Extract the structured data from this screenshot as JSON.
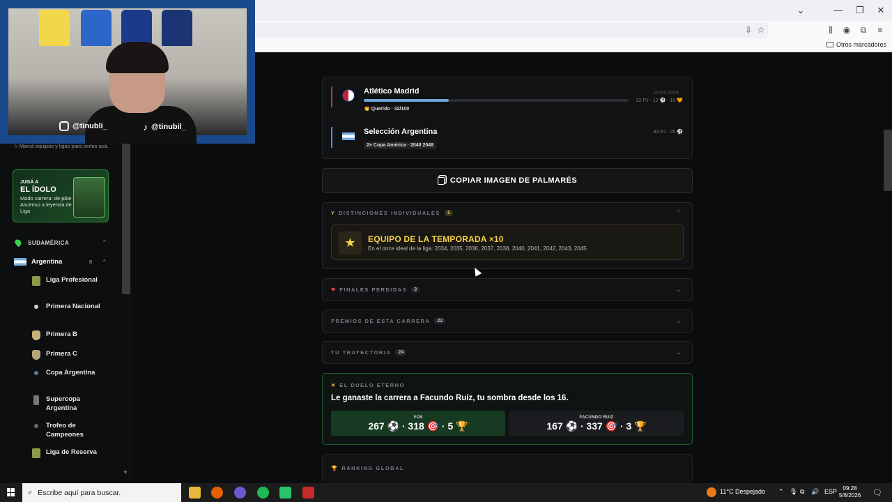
{
  "browser": {
    "bookmarks_other": "Otros marcadores"
  },
  "webcam": {
    "instagram_handle": "@tinubli_",
    "tiktok_handle": "@tinubil_"
  },
  "sidebar": {
    "hint": "Marcá equipos y ligas para verlos acá.",
    "promo": {
      "small": "JUGÁ A",
      "title": "EL ÍDOLO",
      "desc": "Modo carrera: de pibe del Ascenso a leyenda de la Liga"
    },
    "region": "SUDAMÉRICA",
    "country": "Argentina",
    "country_count": "8",
    "leagues": [
      {
        "label": "Liga Profesional"
      },
      {
        "label": "Primera Nacional"
      },
      {
        "label": "Primera B"
      },
      {
        "label": "Primera C"
      },
      {
        "label": "Copa Argentina"
      },
      {
        "label": "Supercopa Argentina"
      },
      {
        "label": "Trofeo de Campeones"
      },
      {
        "label": "Liga de Reserva"
      }
    ]
  },
  "career": [
    {
      "club": "Atlético Madrid",
      "years": "2049-2049",
      "stats": "22 PJ · 12 ⚽ · 10 🧡",
      "tag": "👏 Querido · 32/100",
      "progress": 0.32
    },
    {
      "club": "Selección Argentina",
      "stats": "93 PJ · 26 ⚽",
      "tag": "2× Copa América · 2040 2048"
    }
  ],
  "copy_button": "COPIAR IMAGEN DE PALMARÉS",
  "sections": {
    "distinciones": {
      "label": "DISTINCIONES INDIVIDUALES",
      "count": "1"
    },
    "finales": {
      "label": "FINALES PERDIDAS",
      "count": "3"
    },
    "premios": {
      "label": "PREMIOS DE ESTA CARRERA",
      "count": "22"
    },
    "trayectoria": {
      "label": "TU TRAYECTORIA",
      "count": "24"
    },
    "ranking": {
      "label": "RANKING GLOBAL"
    }
  },
  "award": {
    "title": "EQUIPO DE LA TEMPORADA ×10",
    "desc": "En el once ideal de la liga: 2034, 2035, 2036, 2037, 2038, 2040, 2041, 2042, 2043, 2045."
  },
  "duel": {
    "label": "EL DUELO ETERNO",
    "title": "Le ganaste la carrera a Facundo Ruiz, tu sombra desde los 16.",
    "you": {
      "name": "VOS",
      "stats": "267 ⚽ · 318 🎯 · 5 🏆"
    },
    "rival": {
      "name": "FACUNDO RUIZ",
      "stats": "167 ⚽ · 337 🎯 · 3 🏆"
    }
  },
  "taskbar": {
    "search_placeholder": "Escribe aquí para buscar.",
    "weather": "11°C  Despejado",
    "lang": "ESP",
    "time": "09:28",
    "date": "5/8/2026"
  },
  "colors": {
    "accent_green": "#39d353",
    "gold": "#f5d34a",
    "duel_you_bg": "#163a22"
  }
}
